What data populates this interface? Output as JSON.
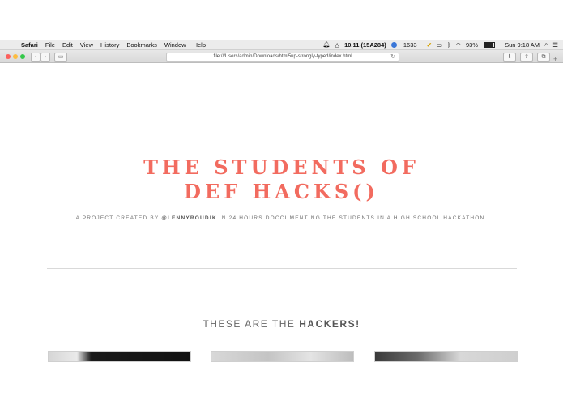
{
  "menubar": {
    "apple_glyph": "",
    "app_name": "Safari",
    "items": [
      "File",
      "Edit",
      "View",
      "History",
      "Bookmarks",
      "Window",
      "Help"
    ],
    "status": {
      "build": "10.11 (15A284)",
      "dropbox_count": "1633",
      "battery": "93%",
      "clock": "Sun 9:18 AM"
    }
  },
  "toolbar": {
    "back_glyph": "‹",
    "forward_glyph": "›",
    "sidebar_glyph": "▭",
    "url": "file:///Users/admin/Downloads/html5up-strongly-typed/index.html",
    "reload_glyph": "↻",
    "download_glyph": "⬇",
    "share_glyph": "⇧",
    "tabs_glyph": "⧉",
    "new_tab_glyph": "+"
  },
  "page": {
    "title_line1": "THE STUDENTS OF",
    "title_line2": "DEF HACKS()",
    "subtitle_before": "A PROJECT CREATED BY ",
    "subtitle_handle": "@LENNYROUDIK",
    "subtitle_after": " IN 24 HOURS DOCCUMENTING THE STUDENTS IN A HIGH SCHOOL HACKATHON.",
    "section_title_prefix": "THESE ARE THE ",
    "section_title_bold": "HACKERS!"
  },
  "colors": {
    "accent": "#f26b5f",
    "text_muted": "#6d6d6d"
  }
}
